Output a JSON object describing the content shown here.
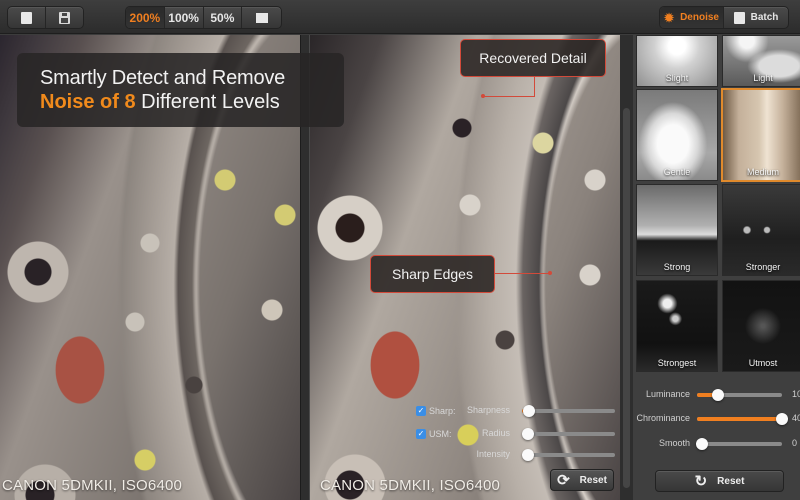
{
  "toolbar": {
    "file_buttons": [
      {
        "icon": "folder-icon",
        "glyph": "▮"
      },
      {
        "icon": "save-icon",
        "glyph": "▤"
      }
    ],
    "zoom_options": [
      {
        "label": "200%",
        "active": true
      },
      {
        "label": "100%",
        "active": false
      },
      {
        "label": "50%",
        "active": false
      },
      {
        "label": "",
        "icon": "fit-screen-icon",
        "active": false
      }
    ],
    "mode_tabs": [
      {
        "label": "Denoise",
        "icon": "gear-icon",
        "glyph": "✹",
        "active": true
      },
      {
        "label": "Batch",
        "icon": "folder-icon",
        "glyph": "▮",
        "active": false
      }
    ]
  },
  "headline": {
    "line1": "Smartly Detect and Remove",
    "line2_accent": "Noise of 8",
    "line2_rest": " Different Levels",
    "accent_color": "#f08a1c"
  },
  "callouts": {
    "detail": "Recovered Detail",
    "edges": "Sharp Edges"
  },
  "captions": {
    "left": "CANON 5DMKII, ISO6400",
    "right": "CANON 5DMKII, ISO6400"
  },
  "sharpen": {
    "sharp_checkbox": {
      "label": "Sharp:",
      "checked": true
    },
    "usm_checkbox": {
      "label": "USM:",
      "checked": true
    },
    "sliders": [
      {
        "label": "Sharpness",
        "value_fraction": 0.08
      },
      {
        "label": "Radius",
        "value_fraction": 0.0
      },
      {
        "label": "Intensity",
        "value_fraction": 0.0
      }
    ],
    "reset_label": "Reset",
    "reset_glyph": "⟳"
  },
  "levels": [
    {
      "label": "Slight",
      "selected": false
    },
    {
      "label": "Light",
      "selected": false
    },
    {
      "label": "Gentle",
      "selected": false
    },
    {
      "label": "Medium",
      "selected": true
    },
    {
      "label": "Strong",
      "selected": false
    },
    {
      "label": "Stronger",
      "selected": false
    },
    {
      "label": "Strongest",
      "selected": false
    },
    {
      "label": "Utmost",
      "selected": false
    }
  ],
  "adjustments": [
    {
      "label": "Luminance",
      "value": "10",
      "fraction": 0.25
    },
    {
      "label": "Chrominance",
      "value": "40",
      "fraction": 1.0
    },
    {
      "label": "Smooth",
      "value": "0",
      "fraction": 0.0
    }
  ],
  "panel_reset": {
    "label": "Reset",
    "glyph": "↻"
  },
  "colors": {
    "accent": "#f07f20",
    "callout_border": "#d24a3a",
    "selected_border": "#e08a2c",
    "checkbox": "#3a8ee6"
  }
}
